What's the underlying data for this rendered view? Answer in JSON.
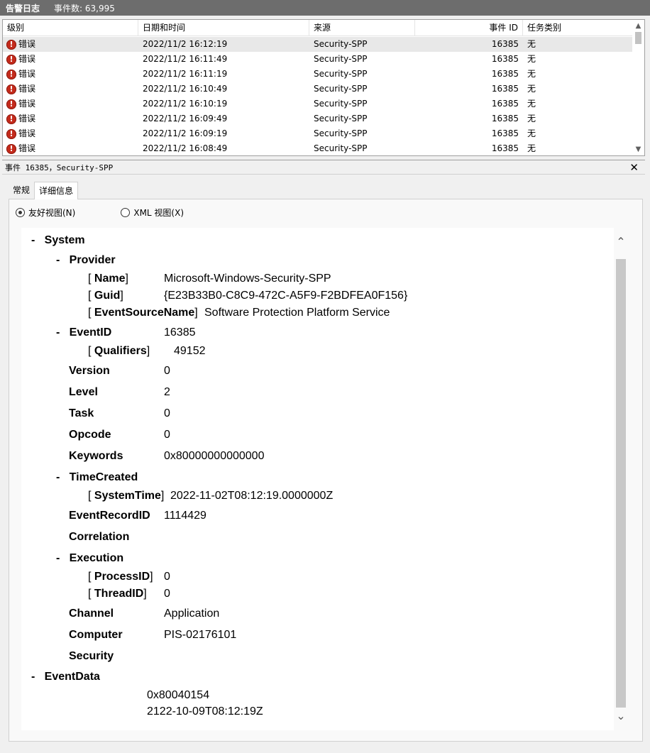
{
  "titlebar": {
    "title": "告警日志",
    "count": "事件数: 63,995"
  },
  "list": {
    "columns": {
      "level": "级别",
      "datetime": "日期和时间",
      "source": "来源",
      "event_id": "事件 ID",
      "task": "任务类别"
    },
    "rows": [
      {
        "level": "错误",
        "datetime": "2022/11/2 16:12:19",
        "source": "Security-SPP",
        "event_id": "16385",
        "task": "无"
      },
      {
        "level": "错误",
        "datetime": "2022/11/2 16:11:49",
        "source": "Security-SPP",
        "event_id": "16385",
        "task": "无"
      },
      {
        "level": "错误",
        "datetime": "2022/11/2 16:11:19",
        "source": "Security-SPP",
        "event_id": "16385",
        "task": "无"
      },
      {
        "level": "错误",
        "datetime": "2022/11/2 16:10:49",
        "source": "Security-SPP",
        "event_id": "16385",
        "task": "无"
      },
      {
        "level": "错误",
        "datetime": "2022/11/2 16:10:19",
        "source": "Security-SPP",
        "event_id": "16385",
        "task": "无"
      },
      {
        "level": "错误",
        "datetime": "2022/11/2 16:09:49",
        "source": "Security-SPP",
        "event_id": "16385",
        "task": "无"
      },
      {
        "level": "错误",
        "datetime": "2022/11/2 16:09:19",
        "source": "Security-SPP",
        "event_id": "16385",
        "task": "无"
      },
      {
        "level": "错误",
        "datetime": "2022/11/2 16:08:49",
        "source": "Security-SPP",
        "event_id": "16385",
        "task": "无"
      }
    ],
    "error_icon_glyph": "!"
  },
  "detail": {
    "header": "事件 16385，Security-SPP",
    "close_glyph": "✕",
    "tabs": {
      "general": "常规",
      "details": "详细信息"
    },
    "radio_friendly": "友好视图(N)",
    "radio_xml": "XML 视图(X)"
  },
  "tree": {
    "minus": "-",
    "lb": "[",
    "rb": "]",
    "system": "System",
    "provider": "Provider",
    "name_key": "Name",
    "name_val": "Microsoft-Windows-Security-SPP",
    "guid_key": "Guid",
    "guid_val": "{E23B33B0-C8C9-472C-A5F9-F2BDFEA0F156}",
    "esn_key": "EventSourceName",
    "esn_val": "Software Protection Platform Service",
    "eventid_key": "EventID",
    "eventid_val": "16385",
    "qual_key": "Qualifiers",
    "qual_val": "49152",
    "version_key": "Version",
    "version_val": "0",
    "level_key": "Level",
    "level_val": "2",
    "task_key": "Task",
    "task_val": "0",
    "opcode_key": "Opcode",
    "opcode_val": "0",
    "keywords_key": "Keywords",
    "keywords_val": "0x80000000000000",
    "timecreated_key": "TimeCreated",
    "systemtime_key": "SystemTime",
    "systemtime_val": "2022-11-02T08:12:19.0000000Z",
    "recordid_key": "EventRecordID",
    "recordid_val": "1114429",
    "correlation_key": "Correlation",
    "execution_key": "Execution",
    "processid_key": "ProcessID",
    "processid_val": "0",
    "threadid_key": "ThreadID",
    "threadid_val": "0",
    "channel_key": "Channel",
    "channel_val": "Application",
    "computer_key": "Computer",
    "computer_val": "PIS-02176101",
    "security_key": "Security",
    "eventdata_key": "EventData",
    "data1": "0x80040154",
    "data2": "2122-10-09T08:12:19Z"
  },
  "icons": {
    "scroll_up": "chevron-up-icon",
    "scroll_down": "chevron-down-icon",
    "error": "error-icon"
  }
}
